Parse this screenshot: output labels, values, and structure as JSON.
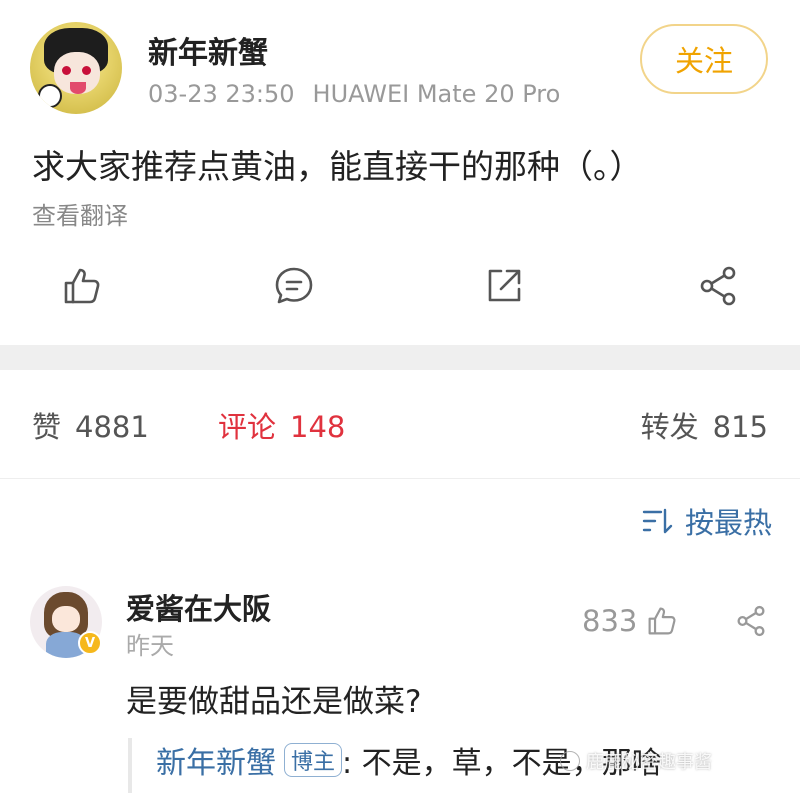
{
  "post": {
    "username": "新年新蟹",
    "date": "03-23 23:50",
    "device": "HUAWEI Mate 20 Pro",
    "follow_label": "关注",
    "text": "求大家推荐点黄油，能直接干的那种（。）",
    "translate_label": "查看翻译",
    "actions": [
      "like-icon",
      "comment-icon",
      "repost-icon",
      "share-icon"
    ]
  },
  "stats": {
    "likes_label": "赞",
    "likes_count": "4881",
    "comments_label": "评论",
    "comments_count": "148",
    "reposts_label": "转发",
    "reposts_count": "815"
  },
  "sort": {
    "label": "按最热",
    "icon": "sort-icon"
  },
  "comment": {
    "username": "爱酱在大阪",
    "time": "昨天",
    "likes": "833",
    "text": "是要做甜品还是做菜?",
    "badge": "V",
    "reply": {
      "username": "新年新蟹",
      "tag": "博主",
      "text": ": 不是，草，不是，那啥"
    }
  },
  "watermark": "鹿鹿秘密趣事酱",
  "colors": {
    "accent_orange": "#f0a300",
    "active_red": "#e0323e",
    "link_blue": "#3a6fa5"
  }
}
